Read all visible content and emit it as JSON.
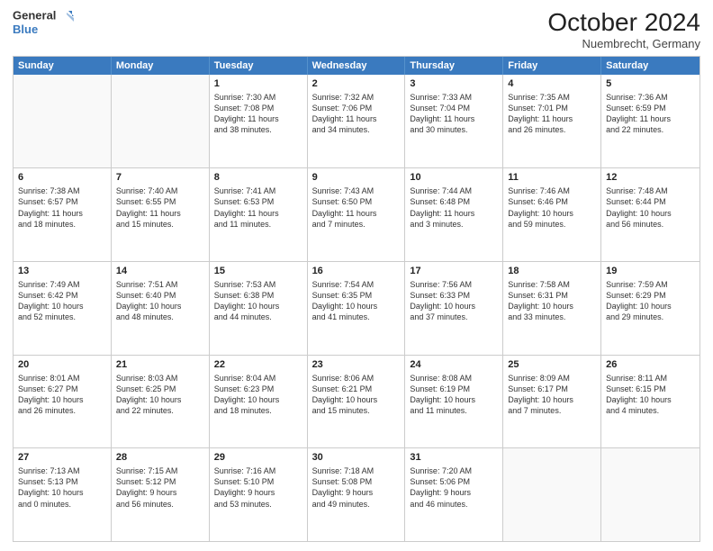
{
  "logo": {
    "line1": "General",
    "line2": "Blue"
  },
  "header": {
    "month": "October 2024",
    "location": "Nuembrecht, Germany"
  },
  "weekdays": [
    "Sunday",
    "Monday",
    "Tuesday",
    "Wednesday",
    "Thursday",
    "Friday",
    "Saturday"
  ],
  "weeks": [
    [
      {
        "day": "",
        "info": ""
      },
      {
        "day": "",
        "info": ""
      },
      {
        "day": "1",
        "info": "Sunrise: 7:30 AM\nSunset: 7:08 PM\nDaylight: 11 hours\nand 38 minutes."
      },
      {
        "day": "2",
        "info": "Sunrise: 7:32 AM\nSunset: 7:06 PM\nDaylight: 11 hours\nand 34 minutes."
      },
      {
        "day": "3",
        "info": "Sunrise: 7:33 AM\nSunset: 7:04 PM\nDaylight: 11 hours\nand 30 minutes."
      },
      {
        "day": "4",
        "info": "Sunrise: 7:35 AM\nSunset: 7:01 PM\nDaylight: 11 hours\nand 26 minutes."
      },
      {
        "day": "5",
        "info": "Sunrise: 7:36 AM\nSunset: 6:59 PM\nDaylight: 11 hours\nand 22 minutes."
      }
    ],
    [
      {
        "day": "6",
        "info": "Sunrise: 7:38 AM\nSunset: 6:57 PM\nDaylight: 11 hours\nand 18 minutes."
      },
      {
        "day": "7",
        "info": "Sunrise: 7:40 AM\nSunset: 6:55 PM\nDaylight: 11 hours\nand 15 minutes."
      },
      {
        "day": "8",
        "info": "Sunrise: 7:41 AM\nSunset: 6:53 PM\nDaylight: 11 hours\nand 11 minutes."
      },
      {
        "day": "9",
        "info": "Sunrise: 7:43 AM\nSunset: 6:50 PM\nDaylight: 11 hours\nand 7 minutes."
      },
      {
        "day": "10",
        "info": "Sunrise: 7:44 AM\nSunset: 6:48 PM\nDaylight: 11 hours\nand 3 minutes."
      },
      {
        "day": "11",
        "info": "Sunrise: 7:46 AM\nSunset: 6:46 PM\nDaylight: 10 hours\nand 59 minutes."
      },
      {
        "day": "12",
        "info": "Sunrise: 7:48 AM\nSunset: 6:44 PM\nDaylight: 10 hours\nand 56 minutes."
      }
    ],
    [
      {
        "day": "13",
        "info": "Sunrise: 7:49 AM\nSunset: 6:42 PM\nDaylight: 10 hours\nand 52 minutes."
      },
      {
        "day": "14",
        "info": "Sunrise: 7:51 AM\nSunset: 6:40 PM\nDaylight: 10 hours\nand 48 minutes."
      },
      {
        "day": "15",
        "info": "Sunrise: 7:53 AM\nSunset: 6:38 PM\nDaylight: 10 hours\nand 44 minutes."
      },
      {
        "day": "16",
        "info": "Sunrise: 7:54 AM\nSunset: 6:35 PM\nDaylight: 10 hours\nand 41 minutes."
      },
      {
        "day": "17",
        "info": "Sunrise: 7:56 AM\nSunset: 6:33 PM\nDaylight: 10 hours\nand 37 minutes."
      },
      {
        "day": "18",
        "info": "Sunrise: 7:58 AM\nSunset: 6:31 PM\nDaylight: 10 hours\nand 33 minutes."
      },
      {
        "day": "19",
        "info": "Sunrise: 7:59 AM\nSunset: 6:29 PM\nDaylight: 10 hours\nand 29 minutes."
      }
    ],
    [
      {
        "day": "20",
        "info": "Sunrise: 8:01 AM\nSunset: 6:27 PM\nDaylight: 10 hours\nand 26 minutes."
      },
      {
        "day": "21",
        "info": "Sunrise: 8:03 AM\nSunset: 6:25 PM\nDaylight: 10 hours\nand 22 minutes."
      },
      {
        "day": "22",
        "info": "Sunrise: 8:04 AM\nSunset: 6:23 PM\nDaylight: 10 hours\nand 18 minutes."
      },
      {
        "day": "23",
        "info": "Sunrise: 8:06 AM\nSunset: 6:21 PM\nDaylight: 10 hours\nand 15 minutes."
      },
      {
        "day": "24",
        "info": "Sunrise: 8:08 AM\nSunset: 6:19 PM\nDaylight: 10 hours\nand 11 minutes."
      },
      {
        "day": "25",
        "info": "Sunrise: 8:09 AM\nSunset: 6:17 PM\nDaylight: 10 hours\nand 7 minutes."
      },
      {
        "day": "26",
        "info": "Sunrise: 8:11 AM\nSunset: 6:15 PM\nDaylight: 10 hours\nand 4 minutes."
      }
    ],
    [
      {
        "day": "27",
        "info": "Sunrise: 7:13 AM\nSunset: 5:13 PM\nDaylight: 10 hours\nand 0 minutes."
      },
      {
        "day": "28",
        "info": "Sunrise: 7:15 AM\nSunset: 5:12 PM\nDaylight: 9 hours\nand 56 minutes."
      },
      {
        "day": "29",
        "info": "Sunrise: 7:16 AM\nSunset: 5:10 PM\nDaylight: 9 hours\nand 53 minutes."
      },
      {
        "day": "30",
        "info": "Sunrise: 7:18 AM\nSunset: 5:08 PM\nDaylight: 9 hours\nand 49 minutes."
      },
      {
        "day": "31",
        "info": "Sunrise: 7:20 AM\nSunset: 5:06 PM\nDaylight: 9 hours\nand 46 minutes."
      },
      {
        "day": "",
        "info": ""
      },
      {
        "day": "",
        "info": ""
      }
    ]
  ]
}
